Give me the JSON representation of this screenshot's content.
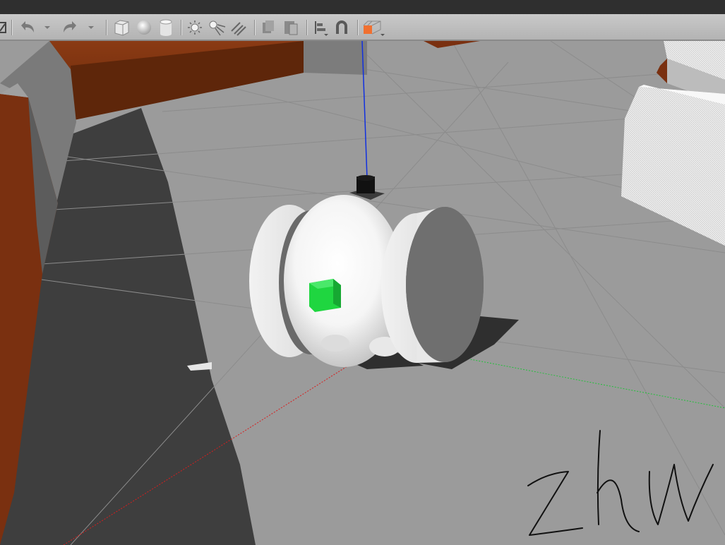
{
  "toolbar": {
    "tools": [
      {
        "name": "translate-mode"
      },
      {
        "name": "undo"
      },
      {
        "name": "undo-history"
      },
      {
        "name": "redo"
      },
      {
        "name": "redo-history"
      },
      {
        "name": "box-shape"
      },
      {
        "name": "sphere-shape"
      },
      {
        "name": "cylinder-shape"
      },
      {
        "name": "point-light"
      },
      {
        "name": "spot-light"
      },
      {
        "name": "directional-light"
      },
      {
        "name": "copy"
      },
      {
        "name": "paste"
      },
      {
        "name": "align"
      },
      {
        "name": "magnet-snap"
      },
      {
        "name": "view-angle"
      }
    ]
  },
  "scene": {
    "signature_text": "zhw"
  },
  "colors": {
    "ground": "#9a9a9a",
    "shadow": "#3d3d3d",
    "wall_orange": "#7a3010",
    "robot_body": "#ffffff",
    "green_sensor": "#1fd640",
    "lidar": "#111111",
    "axis_x": "#d81e1e",
    "axis_y": "#22c03a",
    "axis_z": "#1030e0"
  }
}
